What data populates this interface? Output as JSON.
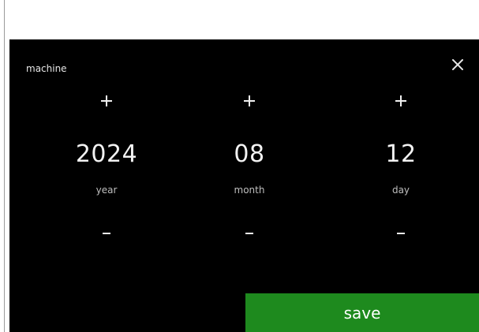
{
  "screen": {
    "title": "machine",
    "close_icon": "close-icon"
  },
  "date": {
    "year": {
      "value": "2024",
      "label": "year",
      "increment_icon": "plus-icon",
      "decrement_icon": "minus-icon"
    },
    "month": {
      "value": "08",
      "label": "month",
      "increment_icon": "plus-icon",
      "decrement_icon": "minus-icon"
    },
    "day": {
      "value": "12",
      "label": "day",
      "increment_icon": "plus-icon",
      "decrement_icon": "minus-icon"
    }
  },
  "actions": {
    "save_label": "save"
  },
  "colors": {
    "background": "#000000",
    "text": "#ffffff",
    "save_button": "#1e8a1e"
  }
}
